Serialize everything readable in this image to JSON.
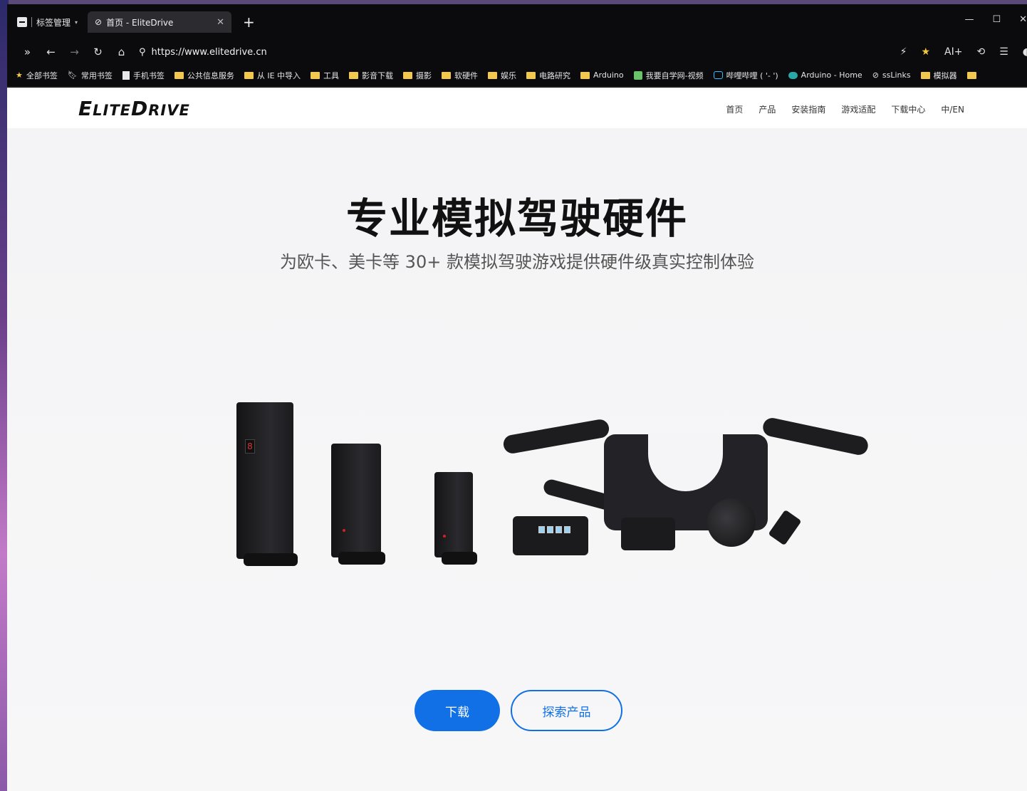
{
  "browser": {
    "tab_manager_label": "标签管理",
    "active_tab_title": "首页 - EliteDrive",
    "url": "https://www.elitedrive.cn",
    "ai_label": "AI+",
    "bookmarks": [
      {
        "label": "全部书签",
        "icon": "star-icon"
      },
      {
        "label": "常用书签",
        "icon": "bookmark-icon"
      },
      {
        "label": "手机书签",
        "icon": "phone-icon"
      },
      {
        "label": "公共信息服务",
        "icon": "folder-icon"
      },
      {
        "label": "从 IE 中导入",
        "icon": "folder-icon"
      },
      {
        "label": "工具",
        "icon": "folder-icon"
      },
      {
        "label": "影音下载",
        "icon": "folder-icon"
      },
      {
        "label": "摄影",
        "icon": "folder-icon"
      },
      {
        "label": "软硬件",
        "icon": "folder-icon"
      },
      {
        "label": "娱乐",
        "icon": "folder-icon"
      },
      {
        "label": "电路研究",
        "icon": "folder-icon"
      },
      {
        "label": "Arduino",
        "icon": "folder-icon"
      },
      {
        "label": "我要自学网-视频",
        "icon": "site-icon"
      },
      {
        "label": "哔哩哔哩 ( '- ')",
        "icon": "bilibili-icon"
      },
      {
        "label": "Arduino - Home",
        "icon": "arduino-icon"
      },
      {
        "label": "ssLinks",
        "icon": "link-icon"
      },
      {
        "label": "模拟器",
        "icon": "folder-icon"
      }
    ]
  },
  "site": {
    "logo_first": "E",
    "logo_mid": "LITE",
    "logo_second": "D",
    "logo_end": "RIVE",
    "nav": [
      "首页",
      "产品",
      "安装指南",
      "游戏适配",
      "下载中心",
      "中/EN"
    ],
    "hero_title": "专业模拟驾驶硬件",
    "hero_subtitle": "为欧卡、美卡等 30+ 款模拟驾驶游戏提供硬件级真实控制体验",
    "primary_button": "下载",
    "secondary_button": "探索产品",
    "display_digit": "8"
  },
  "colors": {
    "accent": "#1170e6",
    "folder": "#f2c94c"
  }
}
